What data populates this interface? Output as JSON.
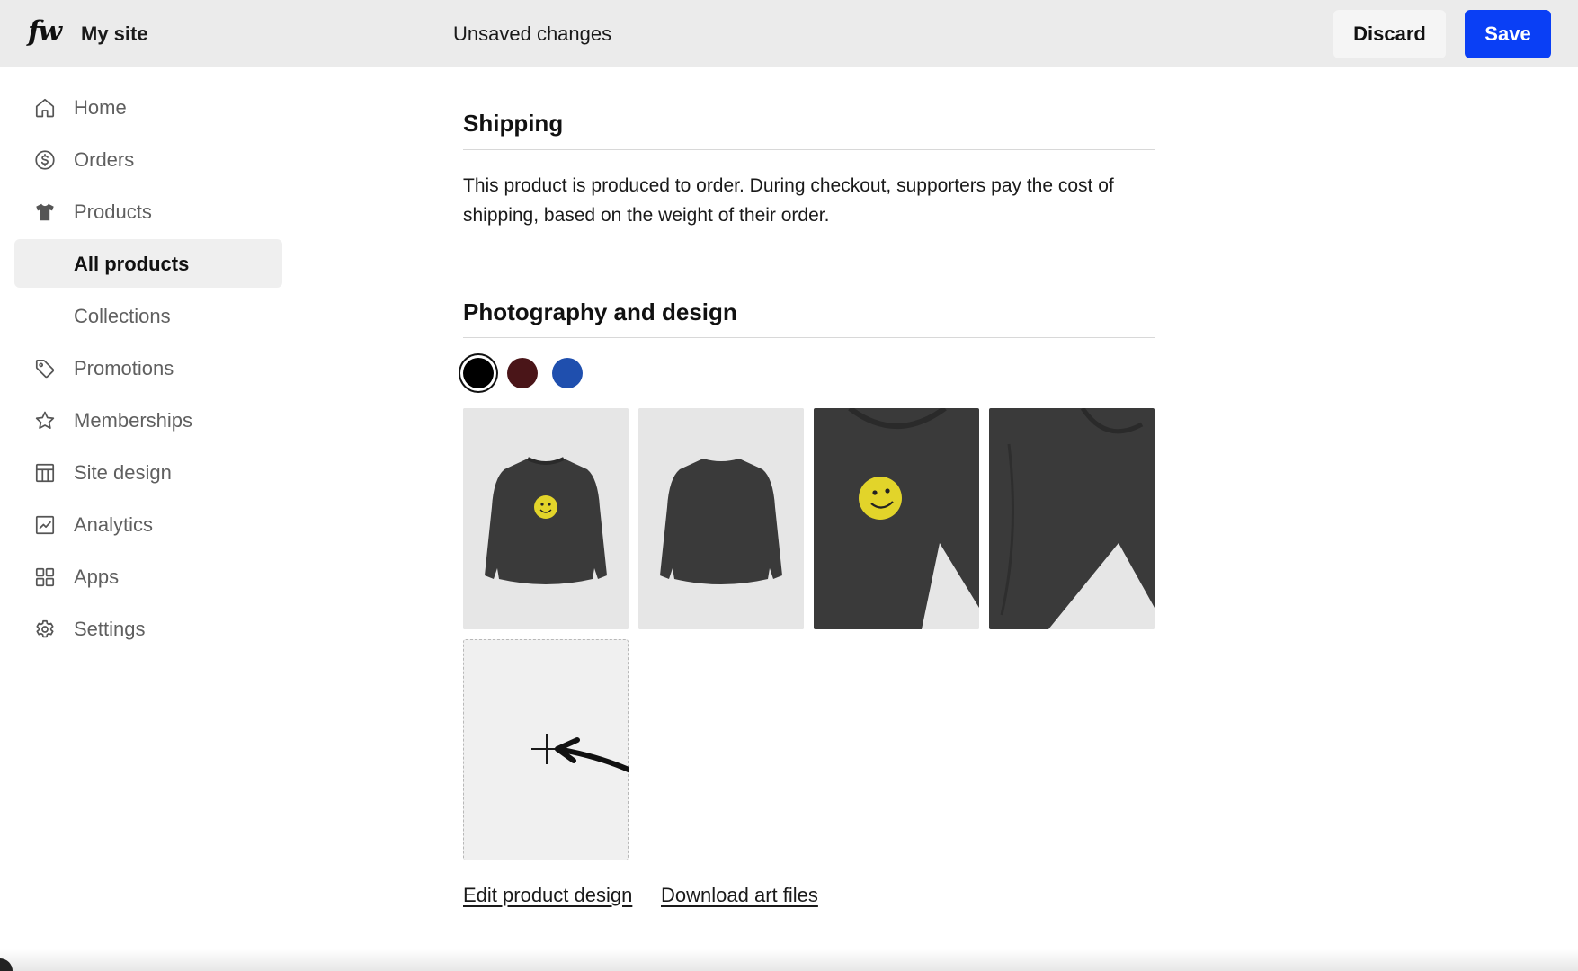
{
  "header": {
    "logo": "fw",
    "site_name": "My site",
    "status": "Unsaved changes",
    "discard_label": "Discard",
    "save_label": "Save"
  },
  "sidebar": {
    "items": [
      {
        "label": "Home",
        "icon": "home-icon"
      },
      {
        "label": "Orders",
        "icon": "dollar-circle-icon"
      },
      {
        "label": "Products",
        "icon": "tshirt-icon"
      },
      {
        "label": "All products",
        "icon": "",
        "active": true
      },
      {
        "label": "Collections",
        "icon": ""
      },
      {
        "label": "Promotions",
        "icon": "tag-icon"
      },
      {
        "label": "Memberships",
        "icon": "star-icon"
      },
      {
        "label": "Site design",
        "icon": "layout-icon"
      },
      {
        "label": "Analytics",
        "icon": "chart-icon"
      },
      {
        "label": "Apps",
        "icon": "grid-icon"
      },
      {
        "label": "Settings",
        "icon": "gear-icon"
      }
    ]
  },
  "main": {
    "shipping": {
      "title": "Shipping",
      "text": "This product is produced to order. During checkout, supporters pay the cost of shipping, based on the weight of their order."
    },
    "photography": {
      "title": "Photography and design",
      "colors": [
        {
          "name": "black",
          "hex": "#000000",
          "selected": true
        },
        {
          "name": "maroon",
          "hex": "#4a1518",
          "selected": false
        },
        {
          "name": "blue",
          "hex": "#1f4fae",
          "selected": false
        }
      ],
      "images": [
        "sweatshirt-front-smiley",
        "sweatshirt-back",
        "sweatshirt-closeup-smiley",
        "sweatshirt-closeup-sleeve"
      ],
      "add_image_icon": "plus-icon",
      "edit_link": "Edit product design",
      "download_link": "Download art files"
    }
  },
  "colors": {
    "accent": "#0a3ff5",
    "topbar_bg": "#ebebeb",
    "active_nav_bg": "#efefef"
  }
}
